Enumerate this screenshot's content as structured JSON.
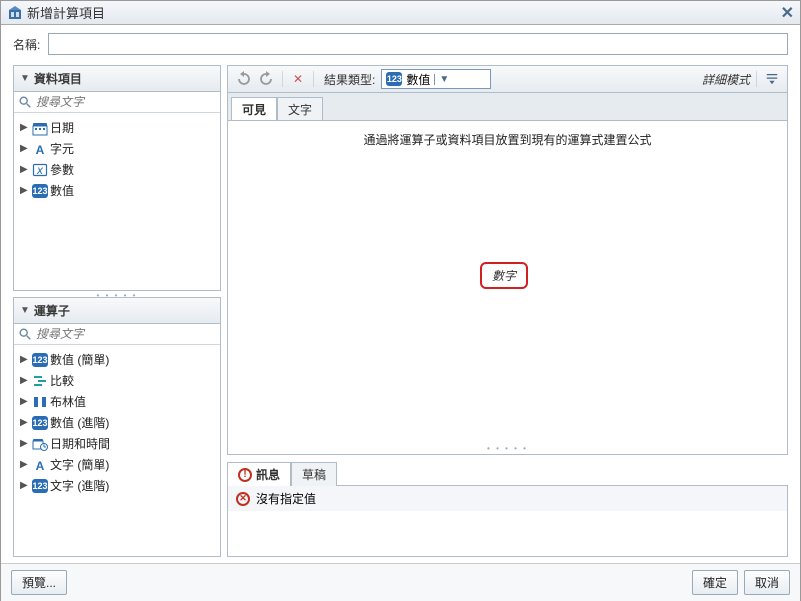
{
  "title": "新增計算項目",
  "name_label": "名稱:",
  "name_value": "",
  "left": {
    "data_items": {
      "header": "資料項目",
      "search_placeholder": "搜尋文字",
      "items": [
        {
          "icon": "calendar",
          "label": "日期"
        },
        {
          "icon": "char",
          "label": "字元"
        },
        {
          "icon": "param",
          "label": "參數"
        },
        {
          "icon": "num",
          "label": "數值"
        }
      ]
    },
    "operators": {
      "header": "運算子",
      "search_placeholder": "搜尋文字",
      "items": [
        {
          "icon": "num",
          "label": "數值 (簡單)"
        },
        {
          "icon": "compare",
          "label": "比較"
        },
        {
          "icon": "bool",
          "label": "布林值"
        },
        {
          "icon": "num",
          "label": "數值 (進階)"
        },
        {
          "icon": "calendar",
          "label": "日期和時間"
        },
        {
          "icon": "char",
          "label": "文字 (簡單)"
        },
        {
          "icon": "num",
          "label": "文字 (進階)"
        }
      ]
    }
  },
  "toolbar": {
    "result_label": "結果類型:",
    "result_value": "數值",
    "detail_mode": "詳細模式"
  },
  "tabs": {
    "visible": "可見",
    "text": "文字"
  },
  "formula": {
    "hint": "通過將運算子或資料項目放置到現有的運算式建置公式",
    "chip": "數字"
  },
  "messages": {
    "tab_messages": "訊息",
    "tab_draft": "草稿",
    "rows": [
      "沒有指定值"
    ]
  },
  "footer": {
    "preview": "預覽...",
    "ok": "確定",
    "cancel": "取消"
  }
}
